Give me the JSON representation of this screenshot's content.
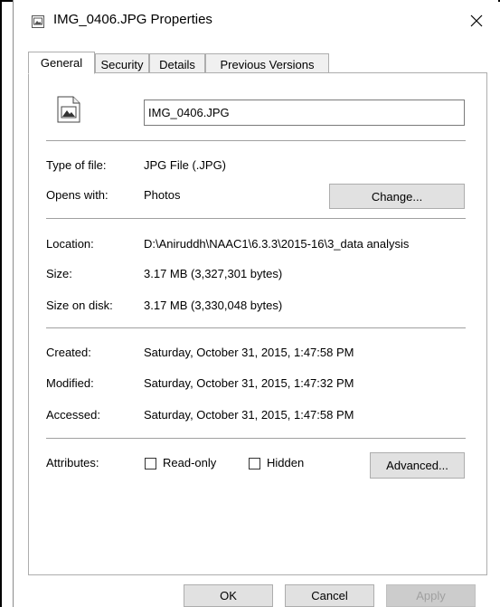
{
  "window": {
    "title": "IMG_0406.JPG Properties",
    "close_glyph": "✕"
  },
  "tabs": [
    {
      "label": "General",
      "active": true
    },
    {
      "label": "Security",
      "active": false
    },
    {
      "label": "Details",
      "active": false
    },
    {
      "label": "Previous Versions",
      "active": false
    }
  ],
  "general": {
    "file_name": "IMG_0406.JPG",
    "type_label": "Type of file:",
    "type_value": "JPG File (.JPG)",
    "opens_label": "Opens with:",
    "opens_value": "Photos",
    "change_button": "Change...",
    "location_label": "Location:",
    "location_value": "D:\\Aniruddh\\NAAC1\\6.3.3\\2015-16\\3_data analysis",
    "size_label": "Size:",
    "size_value": "3.17 MB (3,327,301 bytes)",
    "size_disk_label": "Size on disk:",
    "size_disk_value": "3.17 MB (3,330,048 bytes)",
    "created_label": "Created:",
    "created_value": "Saturday, October 31, 2015, 1:47:58 PM",
    "modified_label": "Modified:",
    "modified_value": "Saturday, October 31, 2015, 1:47:32 PM",
    "accessed_label": "Accessed:",
    "accessed_value": "Saturday, October 31, 2015, 1:47:58 PM",
    "attributes_label": "Attributes:",
    "readonly_label": "Read-only",
    "readonly_checked": false,
    "hidden_label": "Hidden",
    "hidden_checked": false,
    "advanced_button": "Advanced..."
  },
  "footer": {
    "ok": "OK",
    "cancel": "Cancel",
    "apply": "Apply"
  },
  "colors": {
    "button_face": "#e1e1e1",
    "border": "#adadad",
    "separator": "#a0a0a0",
    "disabled_text": "#a0a0a0"
  },
  "icons": {
    "title": "image-file-icon",
    "file": "image-file-icon",
    "close": "close-icon"
  }
}
